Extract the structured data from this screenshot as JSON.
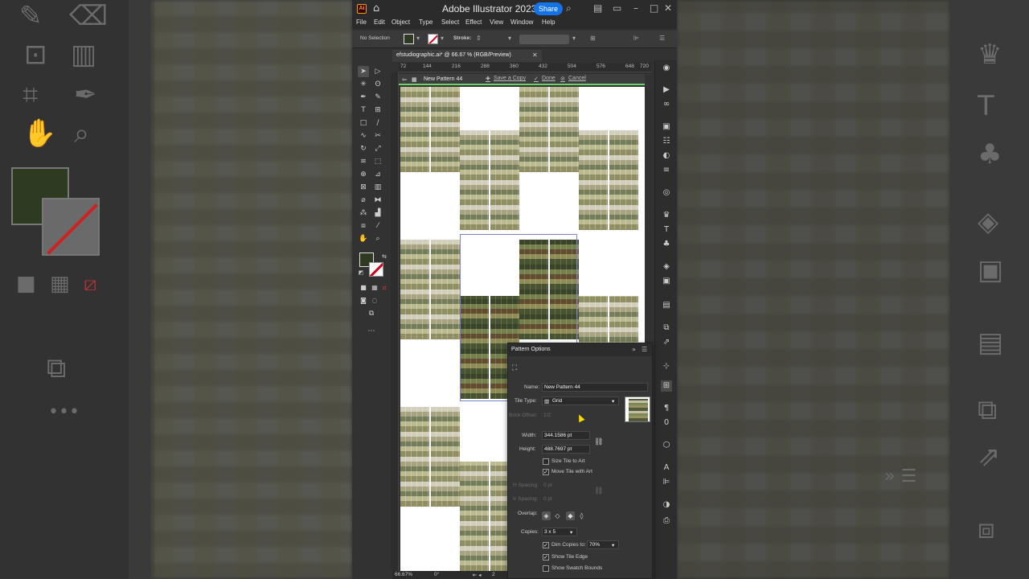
{
  "app": {
    "title": "Adobe Illustrator 2023",
    "share_label": "Share",
    "logo": "Ai"
  },
  "menu": [
    "File",
    "Edit",
    "Object",
    "Type",
    "Select",
    "Effect",
    "View",
    "Window",
    "Help"
  ],
  "control_bar": {
    "selection": "No Selection",
    "stroke_label": "Stroke:",
    "fill_color": "#2f3a22"
  },
  "document": {
    "tab_label": "efstudiographic.ai* @ 66.67 % (RGB/Preview)"
  },
  "ruler": {
    "top": [
      "72",
      "144",
      "216",
      "288",
      "360",
      "432",
      "504",
      "576",
      "648",
      "720"
    ]
  },
  "isolation_bar": {
    "name": "New Pattern 44",
    "save_copy": "Save a Copy",
    "done": "Done",
    "cancel": "Cancel"
  },
  "status_bar": {
    "zoom": "66.67%",
    "rotation": "0°",
    "artboard": "2"
  },
  "pattern_options": {
    "title": "Pattern Options",
    "name_label": "Name:",
    "name_value": "New Pattern 44",
    "tile_type_label": "Tile Type:",
    "tile_type_value": "Grid",
    "brick_offset_label": "Brick Offset:",
    "brick_offset_value": "1/2",
    "width_label": "Width:",
    "width_value": "344.1586 pt",
    "height_label": "Height:",
    "height_value": "488.7697 pt",
    "size_tile_to_art": "Size Tile to Art",
    "move_tile_with_art": "Move Tile with Art",
    "h_spacing_label": "H Spacing:",
    "h_spacing_value": "0 pt",
    "v_spacing_label": "V Spacing:",
    "v_spacing_value": "0 pt",
    "overlap_label": "Overlap:",
    "copies_label": "Copies:",
    "copies_value": "3 x 5",
    "dim_copies_label": "Dim Copies to:",
    "dim_copies_value": "70%",
    "show_tile_edge": "Show Tile Edge",
    "show_swatch_bounds": "Show Swatch Bounds",
    "size_tile_checked": false,
    "move_tile_checked": true,
    "dim_copies_checked": true,
    "show_tile_edge_checked": true,
    "show_swatch_bounds_checked": false
  }
}
